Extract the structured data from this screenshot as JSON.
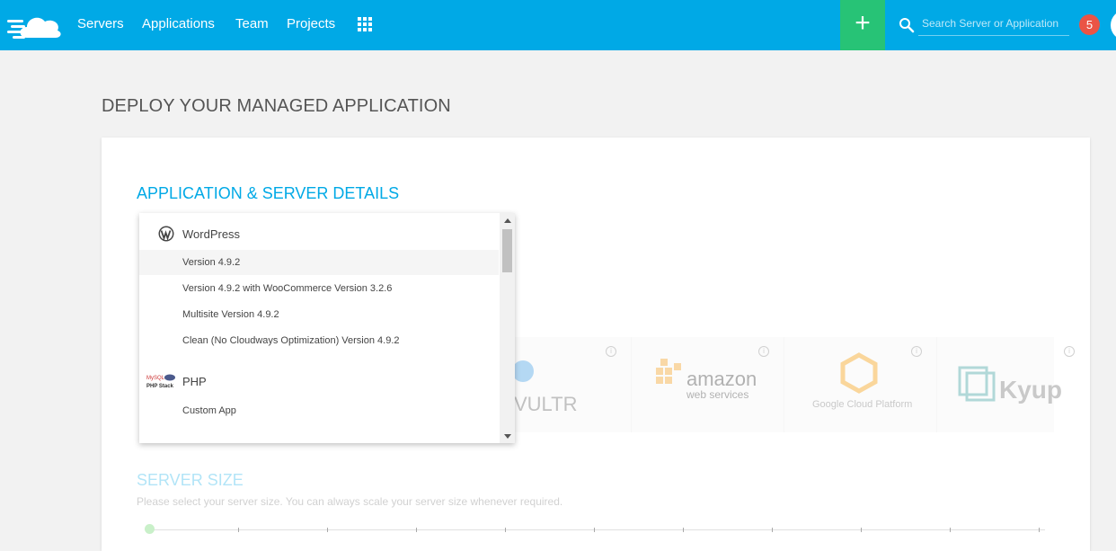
{
  "nav": {
    "items": [
      {
        "label": "Servers"
      },
      {
        "label": "Applications"
      },
      {
        "label": "Team"
      },
      {
        "label": "Projects"
      }
    ],
    "search_placeholder": "Search Server or Application",
    "notification_count": "5",
    "add_label": "+"
  },
  "page": {
    "title": "DEPLOY YOUR MANAGED APPLICATION"
  },
  "card": {
    "section_title": "APPLICATION & SERVER DETAILS",
    "providers": [
      "VULTR",
      "amazon web services",
      "Google Cloud Platform",
      "Kyup"
    ],
    "server_size_title": "SERVER SIZE",
    "server_size_desc": "Please select your server size. You can always scale your server size whenever required."
  },
  "dropdown": {
    "groups": [
      {
        "label": "WordPress",
        "icon": "wordpress-icon",
        "items": [
          {
            "label": "Version 4.9.2",
            "selected": true
          },
          {
            "label": "Version 4.9.2 with WooCommerce Version 3.2.6"
          },
          {
            "label": "Multisite Version 4.9.2"
          },
          {
            "label": "Clean (No Cloudways Optimization) Version 4.9.2"
          }
        ]
      },
      {
        "label": "PHP",
        "icon": "php-stack-icon",
        "icon_text": [
          "MySQL",
          "PHP Stack"
        ],
        "items": [
          {
            "label": "Custom App"
          }
        ]
      }
    ]
  },
  "colors": {
    "topbar": "#00a9e6",
    "add_button": "#27c376",
    "badge": "#ea5445",
    "accent": "#00a9e6"
  }
}
